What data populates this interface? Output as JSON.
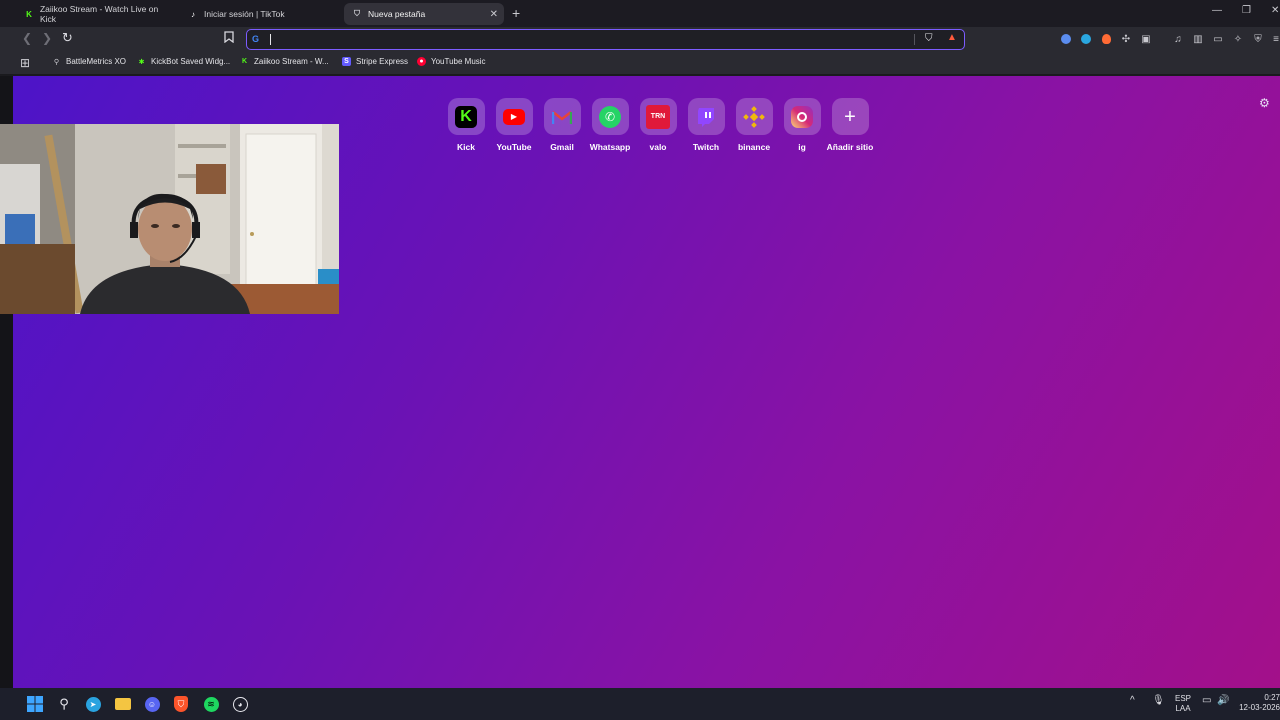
{
  "tabs": [
    {
      "title": "Zaiikoo Stream - Watch Live on Kick"
    },
    {
      "title": "Iniciar sesión | TikTok"
    },
    {
      "title": "Nueva pestaña"
    }
  ],
  "bookmarks": [
    {
      "label": "BattleMetrics XO"
    },
    {
      "label": "KickBot Saved Widg..."
    },
    {
      "label": "Zaiikoo Stream - W..."
    },
    {
      "label": "Stripe Express"
    },
    {
      "label": "YouTube Music"
    }
  ],
  "shortcuts": [
    {
      "label": "Kick",
      "color": "#53fc18"
    },
    {
      "label": "YouTube",
      "color": "#ff0000"
    },
    {
      "label": "Gmail",
      "color": "#ea4335"
    },
    {
      "label": "Whatsapp",
      "color": "#25d366"
    },
    {
      "label": "valo",
      "logo_text": "TRN",
      "color": "#e0193a"
    },
    {
      "label": "Twitch",
      "color": "#9146ff"
    },
    {
      "label": "binance",
      "color": "#f0b90b"
    },
    {
      "label": "ig",
      "color": "#d62976"
    },
    {
      "label": "Añadir sitio"
    }
  ],
  "tray": {
    "lang_top": "ESP",
    "lang_bottom": "LAA",
    "time": "0:27",
    "date": "12-03-2026"
  }
}
